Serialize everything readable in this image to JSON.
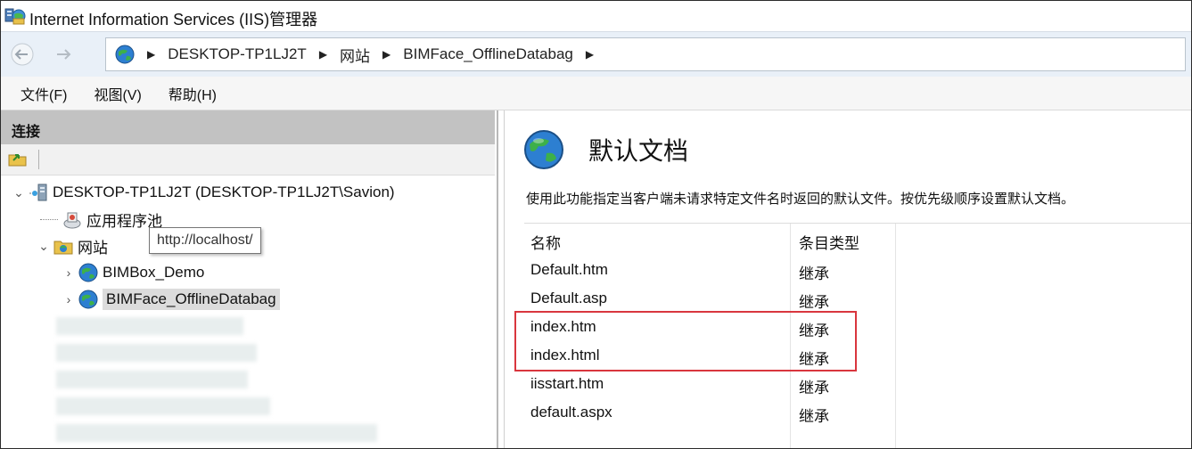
{
  "window": {
    "title": "Internet Information Services (IIS)管理器"
  },
  "address": {
    "crumbs": [
      "DESKTOP-TP1LJ2T",
      "网站",
      "BIMFace_OfflineDatabag"
    ]
  },
  "menu": {
    "file": "文件(F)",
    "view": "视图(V)",
    "help": "帮助(H)"
  },
  "connections": {
    "header": "连接",
    "tree": {
      "server": "DESKTOP-TP1LJ2T (DESKTOP-TP1LJ2T\\Savion)",
      "app_pools": "应用程序池",
      "sites": "网站",
      "site1": "BIMBox_Demo",
      "site2": "BIMFace_OfflineDatabag"
    },
    "tooltip": "http://localhost/"
  },
  "feature": {
    "title": "默认文档",
    "description": "使用此功能指定当客户端未请求特定文件名时返回的默认文件。按优先级顺序设置默认文档。",
    "columns": [
      "名称",
      "条目类型"
    ],
    "rows": [
      {
        "name": "Default.htm",
        "type": "继承"
      },
      {
        "name": "Default.asp",
        "type": "继承"
      },
      {
        "name": "index.htm",
        "type": "继承"
      },
      {
        "name": "index.html",
        "type": "继承"
      },
      {
        "name": "iisstart.htm",
        "type": "继承"
      },
      {
        "name": "default.aspx",
        "type": "继承"
      }
    ]
  },
  "colors": {
    "highlight_border": "#d9363e",
    "panel_header": "#c2c2c2",
    "address_bg": "#e9f0f8"
  },
  "icons": [
    "iis-app-icon",
    "back-arrow-icon",
    "forward-arrow-icon",
    "globe-icon",
    "connect-icon",
    "server-icon",
    "app-pool-icon",
    "folder-icon"
  ]
}
